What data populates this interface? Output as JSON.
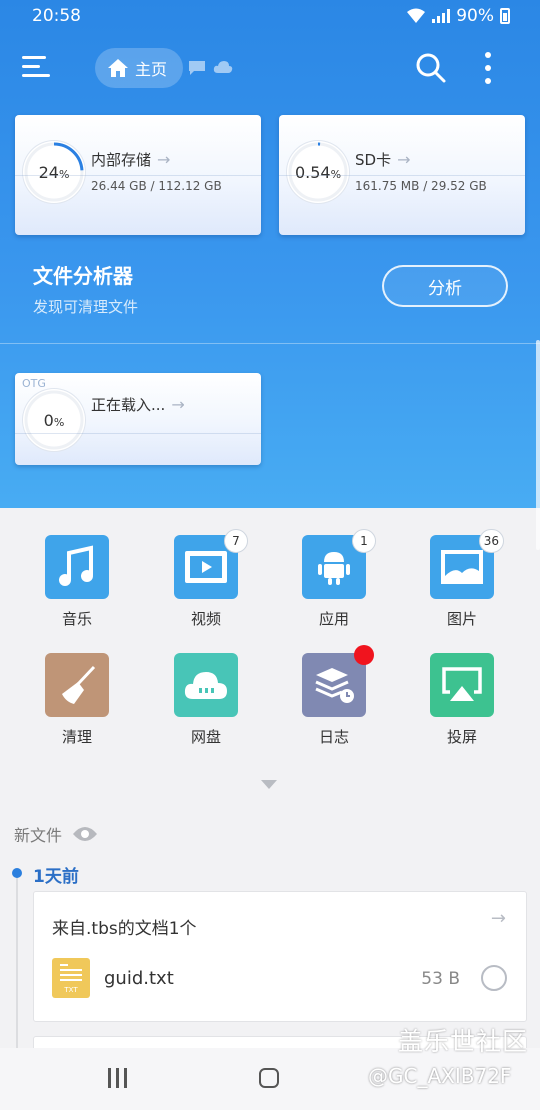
{
  "status": {
    "time": "20:58",
    "battery": "90%"
  },
  "appbar": {
    "home_label": "主页",
    "icons": [
      "menu-icon",
      "home-icon",
      "chat-icon",
      "cloud-icon",
      "search-icon",
      "more-vert-icon"
    ]
  },
  "storage": [
    {
      "name": "内部存储",
      "percent": "24",
      "percent_unit": "%",
      "usage": "26.44 GB / 112.12 GB",
      "fraction": 0.24
    },
    {
      "name": "SD卡",
      "percent": "0.54",
      "percent_unit": "%",
      "usage": "161.75 MB / 29.52 GB",
      "fraction": 0.0054
    },
    {
      "tag": "OTG",
      "name": "正在载入...",
      "percent": "0",
      "percent_unit": "%",
      "fraction": 0
    }
  ],
  "analyzer": {
    "title": "文件分析器",
    "subtitle": "发现可清理文件",
    "button": "分析"
  },
  "categories": [
    {
      "label": "音乐",
      "icon": "music-icon",
      "color": "#2f9ee8"
    },
    {
      "label": "视频",
      "icon": "video-icon",
      "color": "#2f9ee8",
      "badge": "7"
    },
    {
      "label": "应用",
      "icon": "android-icon",
      "color": "#2f9ee8",
      "badge": "1"
    },
    {
      "label": "图片",
      "icon": "image-icon",
      "color": "#2f9ee8",
      "badge": "36"
    },
    {
      "label": "清理",
      "icon": "broom-icon",
      "color": "#b98f70"
    },
    {
      "label": "网盘",
      "icon": "cloud-drive-icon",
      "color": "#45c2b4"
    },
    {
      "label": "日志",
      "icon": "log-icon",
      "color": "#7d89b3"
    },
    {
      "label": "投屏",
      "icon": "cast-icon",
      "color": "#3cc08d"
    }
  ],
  "recent": {
    "section_title": "新文件",
    "day": "1天前",
    "group_title": "来自.tbs的文档1个",
    "file": {
      "name": "guid.txt",
      "size": "53 B",
      "icon_text": "TXT"
    }
  },
  "watermark": {
    "line1": "盖乐世社区",
    "line2": "@GC_AXIB72F"
  }
}
